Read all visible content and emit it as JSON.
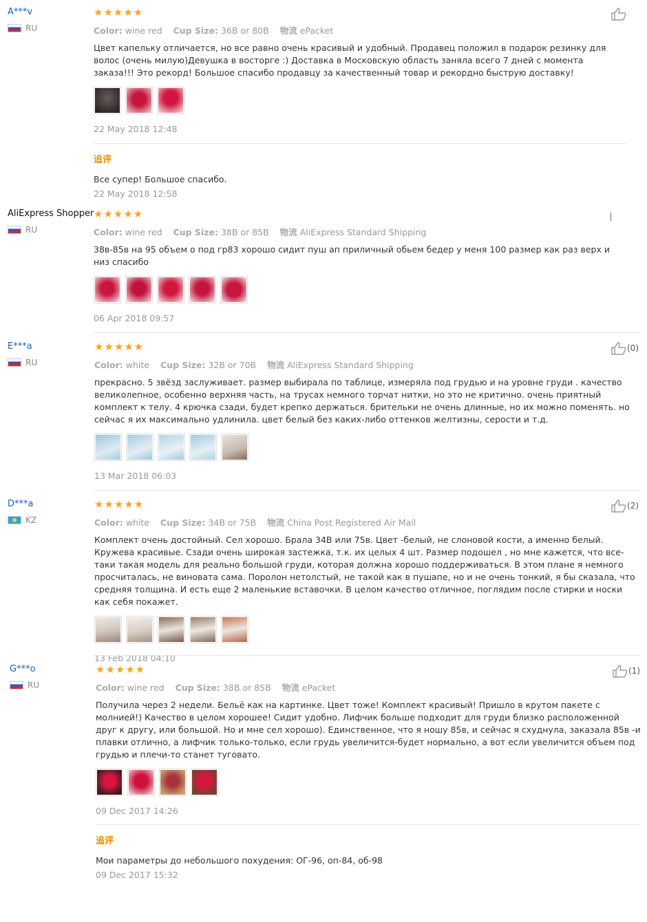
{
  "reviews": [
    {
      "user": "A***v",
      "country": "RU",
      "stars": "★★★★★",
      "color_label": "Color:",
      "color_value": "wine red",
      "size_label": "Cup Size:",
      "size_value": "36B or 80B",
      "ship_label": "物流",
      "ship_value": "ePacket",
      "text": "Цвет капельку отличается, но все равно очень красивый и удобный. Продавец положил в подарок резинку для волос (очень милую)Девушка в восторге :) Доставка в Московскую область заняла всего 7 дней с момента заказа!!! Это рекорд! Большое спасибо продавцу за качественный товар и рекордно быструю доставку!",
      "date": "22 May 2018 12:48",
      "followup_label": "追评",
      "followup_text": "Все супер! Большое спасибо.",
      "followup_date": "22 May 2018 12:58",
      "helpful_count": ""
    },
    {
      "user": "AliExpress Shopper",
      "country": "RU",
      "stars": "★★★★★",
      "color_label": "Color:",
      "color_value": "wine red",
      "size_label": "Cup Size:",
      "size_value": "38B or 85B",
      "ship_label": "物流",
      "ship_value": "AliExpress Standard Shipping",
      "text": "38в-85в на 95 объем о под гр83 хорошо сидит пуш ап приличный обьем бедер у меня 100 размер как раз верх и низ спасибо",
      "date": "06 Apr 2018 09:57",
      "helpful_count": ""
    },
    {
      "user": "E***a",
      "country": "RU",
      "stars": "★★★★★",
      "color_label": "Color:",
      "color_value": "white",
      "size_label": "Cup Size:",
      "size_value": "32B or 70B",
      "ship_label": "物流",
      "ship_value": "AliExpress Standard Shipping",
      "text": "прекрасно. 5 звёзд заслуживает. размер выбирала по таблице, измеряла под грудью и на уровне груди . качество великолепное, особенно верхняя часть, на трусах немного торчат нитки, но это не критично. очень приятный комплект к телу. 4 крючка сзади, будет крепко держаться. брительки не очень длинные, но их можно поменять. но сейчас я их максимально удлинила. цвет белый без каких-либо оттенков желтизны, серости и т.д.",
      "date": "13 Mar 2018 06:03",
      "helpful_count": "(0)"
    },
    {
      "user": "D***a",
      "country": "KZ",
      "stars": "★★★★★",
      "color_label": "Color:",
      "color_value": "white",
      "size_label": "Cup Size:",
      "size_value": "34B or 75B",
      "ship_label": "物流",
      "ship_value": "China Post Registered Air Mail",
      "text": "Комплект очень достойный. Сел хорошо. Брала 34В или 75в. Цвет -белый, не слоновой кости, а именно белый. Кружева красивые. Сзади очень широкая застежка, т.к. их целых 4 шт. Размер подошел , но мне кажется, что все-таки такая модель для реально большой груди, которая должна хорошо поддерживаться. В этом плане я немного просчиталась, не виновата сама. Поролон нетолстый, не такой как в пушапе, но и не очень тонкий, я бы сказала, что средняя толщина. И есть еще 2 маленькие вставочки. В целом качество отличное, поглядим после стирки и носки как себя покажет.",
      "date": "13 Feb 2018 04:10",
      "helpful_count": "(2)"
    },
    {
      "user": "G***o",
      "country": "RU",
      "stars": "★★★★★",
      "color_label": "Color:",
      "color_value": "wine red",
      "size_label": "Cup Size:",
      "size_value": "38B or 85B",
      "ship_label": "物流",
      "ship_value": "ePacket",
      "text": "Получила через 2 недели. Бельё как на картинке. Цвет тоже! Комплект красивый! Пришло в крутом пакете с молнией!) Качество в целом хорошее! Сидит удобно. Лифчик больше подходит для груди близко расположенной друг к другу, или большой. Но и мне сел хорошо). Единственное, что я ношу 85в, и сейчас я схуднула, заказала 85в -и плавки отлично, а лифчик только-только, если грудь увеличится-будет нормально, а вот если увеличится объем под грудью и плечи-то станет туговато.",
      "date": "09 Dec 2017 14:26",
      "followup_label": "追评",
      "followup_text": "Мои параметры до небольшого похудения: ОГ-96, оп-84, об-98",
      "followup_date": "09 Dec 2017 15:32",
      "helpful_count": "(1)"
    }
  ]
}
